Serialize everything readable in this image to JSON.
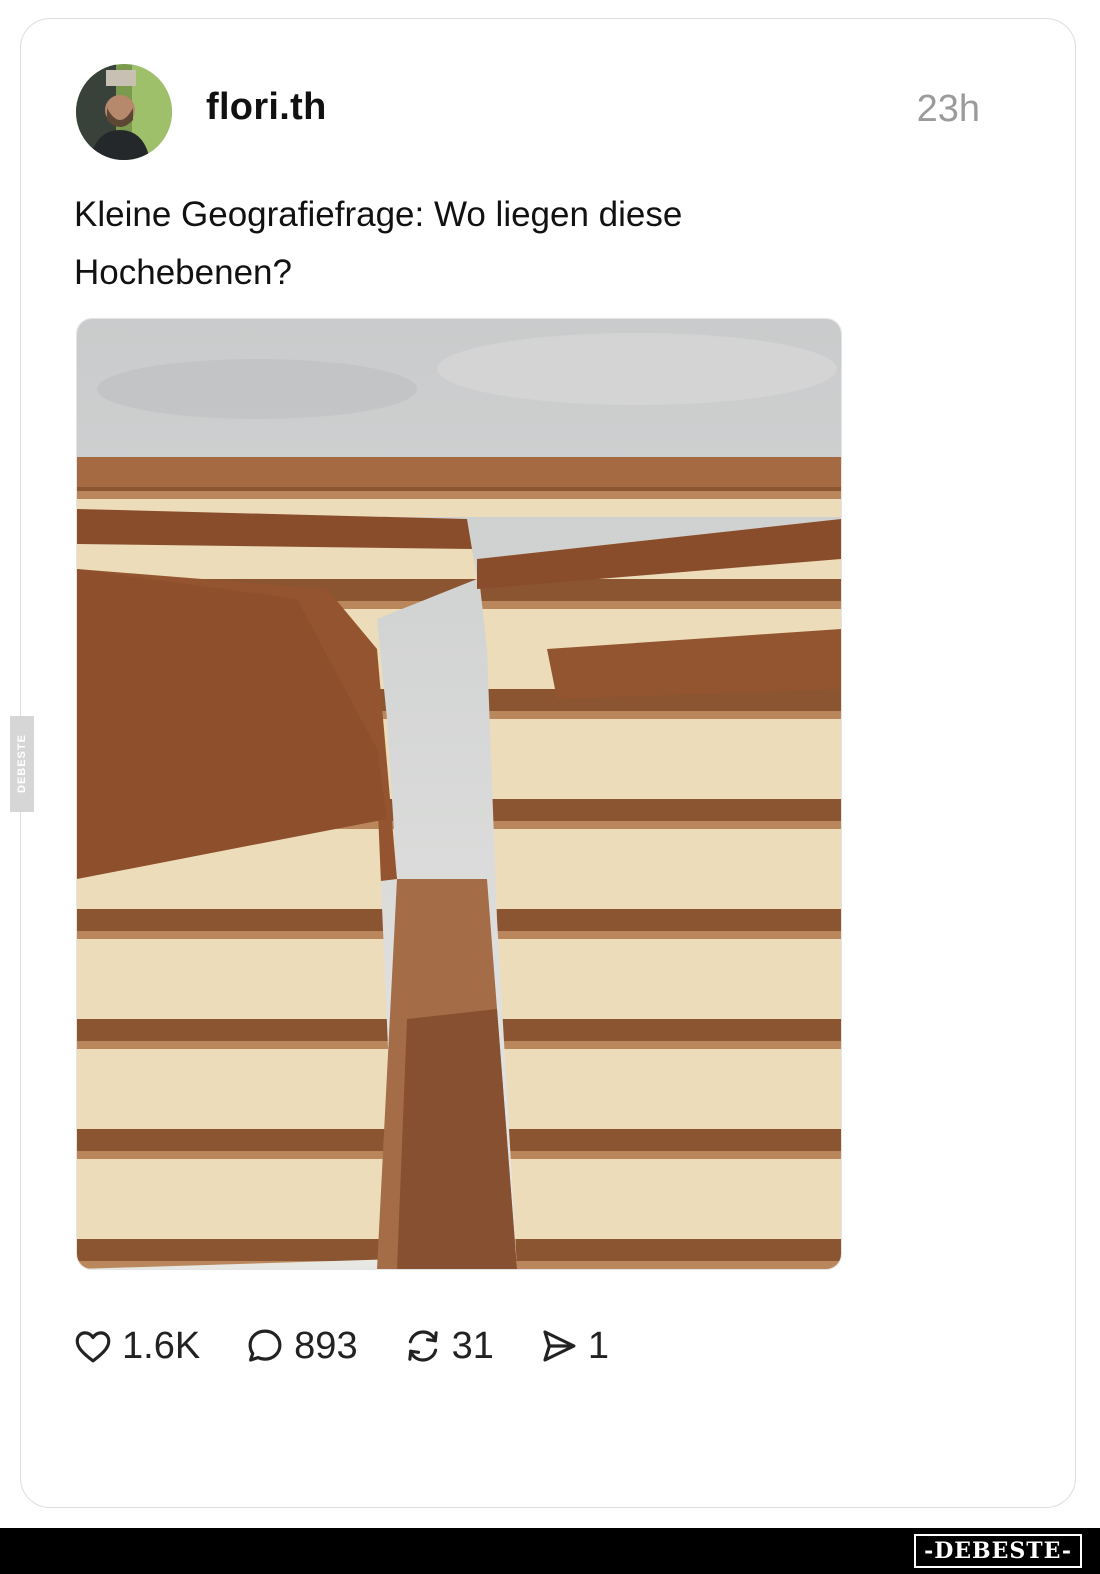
{
  "post": {
    "username": "flori.th",
    "timestamp": "23h",
    "text": "Kleine Geografiefrage: Wo liegen diese Hochebenen?"
  },
  "actions": {
    "likes": "1.6K",
    "comments": "893",
    "reposts": "31",
    "shares": "1"
  },
  "icons": {
    "like": "heart-icon",
    "comment": "speech-bubble-icon",
    "repost": "repost-arrows-icon",
    "share": "send-icon"
  },
  "watermark": {
    "side_text": "DEBESTE",
    "footer_text": "-DEBESTE-"
  },
  "colors": {
    "text": "#111111",
    "muted": "#9b9b9b",
    "cocoa": "#7a4426",
    "cream": "#efe0bf"
  }
}
